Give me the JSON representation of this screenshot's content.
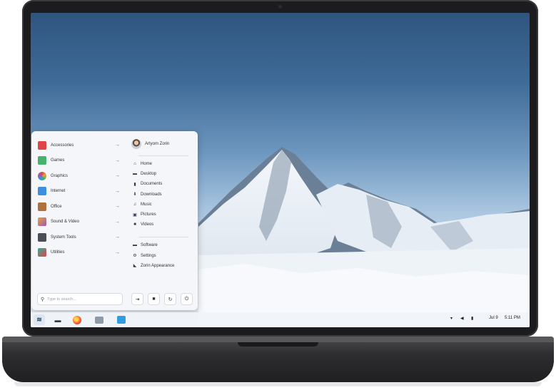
{
  "menu": {
    "categories": [
      {
        "label": "Accessories",
        "icon": "accessories-icon",
        "color": "#e04545"
      },
      {
        "label": "Games",
        "icon": "games-icon",
        "color": "#45b36b"
      },
      {
        "label": "Graphics",
        "icon": "graphics-icon",
        "color": "#e8a33a"
      },
      {
        "label": "Internet",
        "icon": "internet-icon",
        "color": "#3d8fe0"
      },
      {
        "label": "Office",
        "icon": "office-icon",
        "color": "#e07b3d"
      },
      {
        "label": "Sound & Video",
        "icon": "sound-video-icon",
        "color": "#9b59b6"
      },
      {
        "label": "System Tools",
        "icon": "system-tools-icon",
        "color": "#4a4f57"
      },
      {
        "label": "Utilities",
        "icon": "utilities-icon",
        "color": "#2fae9a"
      }
    ],
    "user": "Artyom Zorin",
    "places": [
      {
        "label": "Home",
        "icon": "home-icon",
        "glyph": "⌂"
      },
      {
        "label": "Desktop",
        "icon": "desktop-icon",
        "glyph": "▬"
      },
      {
        "label": "Documents",
        "icon": "documents-icon",
        "glyph": "▮"
      },
      {
        "label": "Downloads",
        "icon": "downloads-icon",
        "glyph": "⬇"
      },
      {
        "label": "Music",
        "icon": "music-icon",
        "glyph": "♫"
      },
      {
        "label": "Pictures",
        "icon": "pictures-icon",
        "glyph": "▣"
      },
      {
        "label": "Videos",
        "icon": "videos-icon",
        "glyph": "■"
      }
    ],
    "system": [
      {
        "label": "Software",
        "icon": "software-icon",
        "glyph": "▬"
      },
      {
        "label": "Settings",
        "icon": "settings-icon",
        "glyph": "⚙"
      },
      {
        "label": "Zorin Appearance",
        "icon": "appearance-icon",
        "glyph": "◣"
      }
    ],
    "search_placeholder": "Type to search...",
    "arrow": "→"
  },
  "taskbar": {
    "date": "Jul 9",
    "time": "5:11 PM"
  }
}
